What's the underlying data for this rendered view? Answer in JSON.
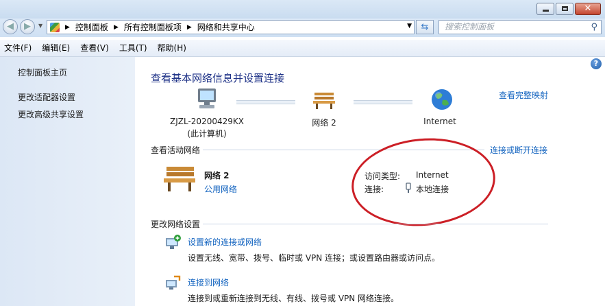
{
  "address": {
    "crumbs": [
      "控制面板",
      "所有控制面板项",
      "网络和共享中心"
    ],
    "search_placeholder": "搜索控制面板"
  },
  "menu": [
    "文件(F)",
    "编辑(E)",
    "查看(V)",
    "工具(T)",
    "帮助(H)"
  ],
  "sidebar": {
    "items": [
      "控制面板主页",
      "更改适配器设置",
      "更改高级共享设置"
    ]
  },
  "main": {
    "title": "查看基本网络信息并设置连接",
    "view_full_map": "查看完整映射",
    "map": {
      "computer_name": "ZJZL-20200429KX",
      "computer_sub": "(此计算机)",
      "network": "网络  2",
      "internet": "Internet"
    },
    "active_section": "查看活动网络",
    "connect_disconnect": "连接或断开连接",
    "active": {
      "name": "网络  2",
      "type": "公用网络",
      "access_label": "访问类型:",
      "access_value": "Internet",
      "conn_label": "连接:",
      "conn_value": "本地连接"
    },
    "change_section": "更改网络设置",
    "tasks": [
      {
        "title": "设置新的连接或网络",
        "desc": "设置无线、宽带、拨号、临时或 VPN 连接；或设置路由器或访问点。"
      },
      {
        "title": "连接到网络",
        "desc": "连接到或重新连接到无线、有线、拨号或 VPN 网络连接。"
      }
    ]
  },
  "colors": {
    "link": "#1565c0",
    "title": "#1e3287",
    "annotation_ellipse": "#cc1f26"
  }
}
